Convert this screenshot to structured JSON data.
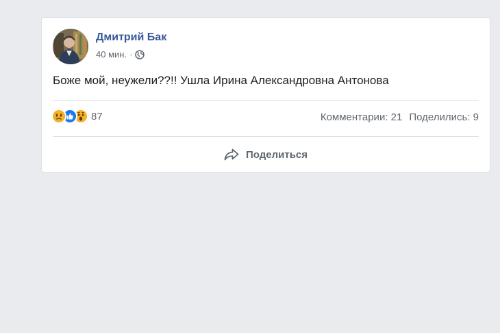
{
  "post": {
    "author": "Дмитрий Бак",
    "time": "40 мин.",
    "separator": "·",
    "privacy_icon": "globe-icon",
    "text": "Боже мой, неужели??!! Ушла Ирина Александровна Антонова",
    "reactions": {
      "icons": [
        "sad-reaction-icon",
        "like-reaction-icon",
        "wow-reaction-icon"
      ],
      "count": "87"
    },
    "comments": "Комментарии: 21",
    "shares": "Поделились: 9",
    "share_button": "Поделиться"
  },
  "colors": {
    "background": "#e9ebee",
    "author_link": "#385898",
    "like_blue": "#1877f2",
    "emoji_yellow": "#f7b125"
  }
}
